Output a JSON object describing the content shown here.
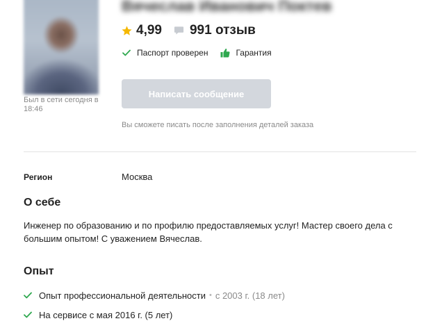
{
  "profile": {
    "name": "Вячеслав Иванович Поктев",
    "online_status": "Был в сети сегодня в 18:46",
    "rating": "4,99",
    "reviews": "991 отзыв",
    "badges": {
      "passport": "Паспорт проверен",
      "guarantee": "Гарантия"
    },
    "message_button": "Написать сообщение",
    "message_hint": "Вы сможете писать после заполнения деталей заказа"
  },
  "region": {
    "label": "Регион",
    "value": "Москва"
  },
  "about": {
    "title": "О себе",
    "text": "Инженер по образованию и по профилю предоставляемых услуг! Мастер своего дела с большим опытом! С уважением Вячеслав."
  },
  "experience": {
    "title": "Опыт",
    "items": [
      {
        "label": "Опыт профессиональной деятельности",
        "detail": "с 2003 г. (18 лет)"
      },
      {
        "label": "На сервисе с мая 2016 г. (5 лет)"
      }
    ]
  },
  "colors": {
    "star": "#f5b800",
    "check": "#2fa84f",
    "thumb": "#2fa84f",
    "button_disabled": "#d3d7dd"
  }
}
